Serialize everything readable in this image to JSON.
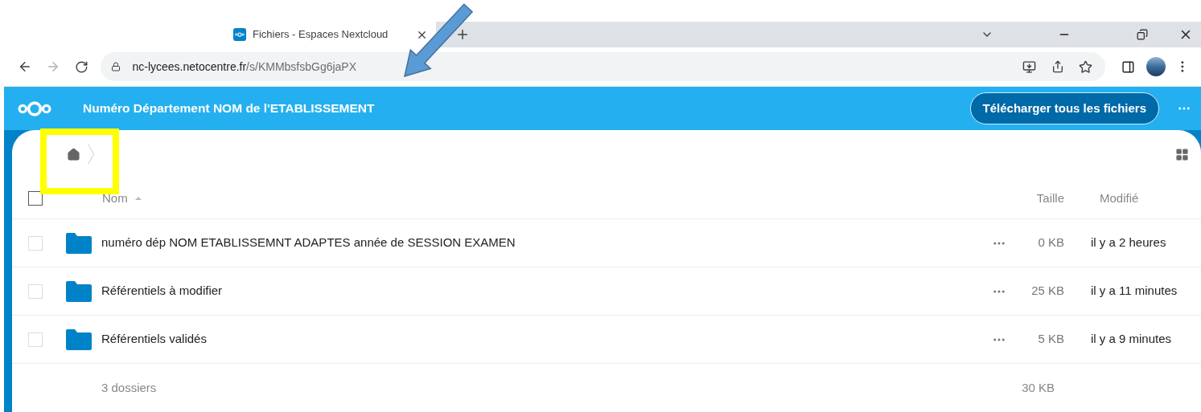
{
  "browser": {
    "tab": {
      "title": "Fichiers - Espaces Nextcloud",
      "selected": true
    },
    "url_host": "nc-lycees.netocentre.fr",
    "url_path": "/s/KMMbsfsbGg6jaPX"
  },
  "header": {
    "title": "Numéro Département NOM de l'ETABLISSEMENT",
    "download_button": "Télécharger tous les fichiers"
  },
  "table": {
    "select_all": {
      "checked": false
    },
    "columns": [
      "Nom",
      "Taille",
      "Modifié"
    ],
    "rows": [
      {
        "name": "numéro dép NOM ETABLISSEMNT ADAPTES année de SESSION EXAMEN",
        "size": "0 KB",
        "modified": "il y a 2 heures",
        "selected": false
      },
      {
        "name": "Référentiels à modifier",
        "size": "25 KB",
        "modified": "il y a 11 minutes",
        "selected": false
      },
      {
        "name": "Référentiels validés",
        "size": "5 KB",
        "modified": "il y a 9 minutes",
        "selected": false
      }
    ],
    "summary": {
      "count": "3 dossiers",
      "size": "30 KB"
    }
  },
  "annotations": [
    {
      "kind": "arrow",
      "color": "#5b9bd5"
    },
    {
      "kind": "highlight",
      "color": "#ffff00"
    }
  ]
}
